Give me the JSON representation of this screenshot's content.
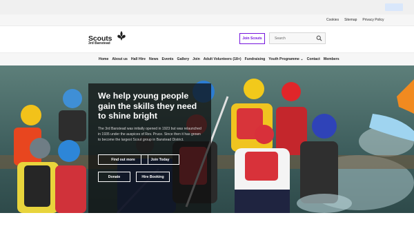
{
  "utility": {
    "links": [
      "Cookies",
      "Sitemap",
      "Privacy Policy"
    ]
  },
  "brand": {
    "name": "Scouts",
    "group": "3rd Banstead"
  },
  "header": {
    "join_label": "Join Scouts",
    "search_placeholder": "Search"
  },
  "nav": {
    "items": [
      "Home",
      "About us",
      "Hall Hire",
      "News",
      "Events",
      "Gallery",
      "Join",
      "Adult Volunteers (18+)",
      "Fundraising",
      "Youth Programme",
      "Contact",
      "Members"
    ]
  },
  "hero": {
    "headline": "We help young people gain the skills they need to shine bright",
    "body": "The 3rd Banstead was initially opened in 1923 but was relaunched in 1935 under the auspices of Rev. Pruce. Since then it has grown to become the largest Scout group in Banstead District.",
    "buttons": {
      "find_out_more": "Find out more",
      "join_today": "Join Today",
      "donate": "Donate",
      "hire_booking": "Hire Booking"
    }
  },
  "colors": {
    "brand_purple": "#7413dc",
    "panel_overlay": "#0c0c0c"
  },
  "icons": {
    "logo": "fleur-de-lis-icon",
    "search": "search-icon",
    "dropdown": "chevron-down-icon"
  }
}
